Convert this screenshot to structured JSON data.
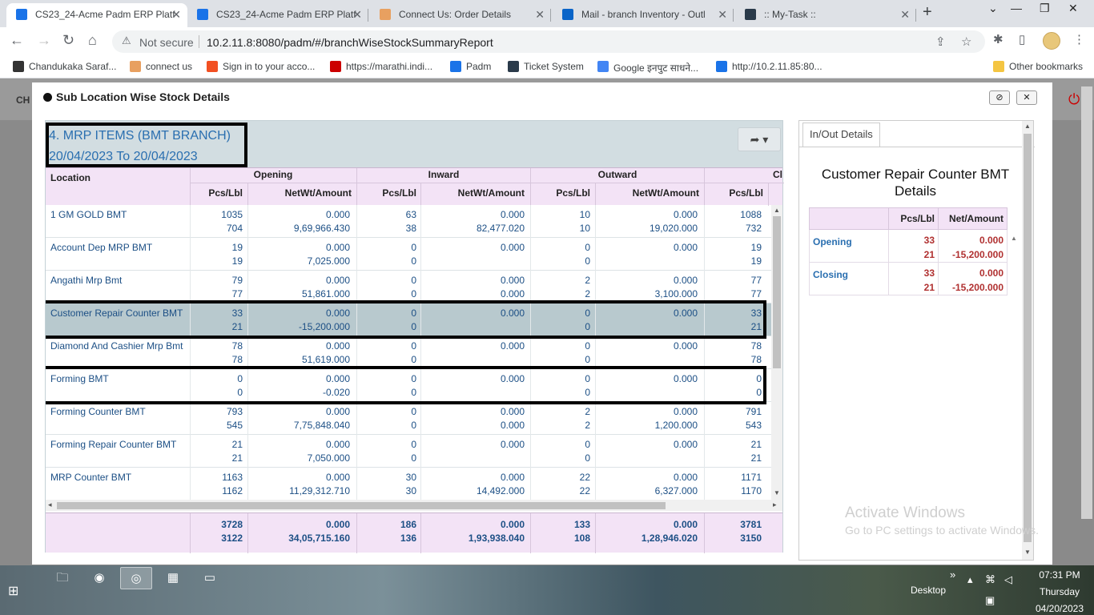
{
  "browser": {
    "tabs": [
      {
        "label": "CS23_24-Acme Padm ERP Platf",
        "active": true,
        "color": "#1a73e8"
      },
      {
        "label": "CS23_24-Acme Padm ERP Platf",
        "active": false,
        "color": "#1a73e8"
      },
      {
        "label": "Connect Us: Order Details",
        "active": false,
        "color": "#e8a060"
      },
      {
        "label": "Mail - branch Inventory - Outl",
        "active": false,
        "color": "#0a64c8"
      },
      {
        "label": ":: My-Task ::",
        "active": false,
        "color": "#2a3a4a"
      }
    ],
    "not_secure": "Not secure",
    "url": "10.2.11.8:8080/padm/#/branchWiseStockSummaryReport",
    "bookmarks": [
      {
        "label": "Chandukaka Saraf...",
        "color": "#333"
      },
      {
        "label": "connect us",
        "color": "#e8a060"
      },
      {
        "label": "Sign in to your acco...",
        "color": "#f25022"
      },
      {
        "label": "https://marathi.indi...",
        "color": "#c00"
      },
      {
        "label": "Padm",
        "color": "#1a73e8"
      },
      {
        "label": "Ticket System",
        "color": "#2a3a4a"
      },
      {
        "label": "Google इनपुट साधने...",
        "color": "#4285f4"
      },
      {
        "label": "http://10.2.11.85:80...",
        "color": "#1a73e8"
      }
    ],
    "other_bookmarks": "Other bookmarks"
  },
  "background": {
    "left_text": "CH"
  },
  "modal": {
    "title": "Sub Location Wise Stock Details",
    "report": {
      "title_line1": "4. MRP ITEMS (BMT BRANCH)",
      "title_line2": "20/04/2023 To 20/04/2023",
      "col_location": "Location",
      "groups": [
        "Opening",
        "Inward",
        "Outward",
        "Cl"
      ],
      "sub_pcs": "Pcs/Lbl",
      "sub_amt": "NetWt/Amount",
      "rows": [
        {
          "loc": "1 GM GOLD BMT",
          "op_p1": "1035",
          "op_p2": "704",
          "op_a1": "0.000",
          "op_a2": "9,69,966.430",
          "in_p1": "63",
          "in_p2": "38",
          "in_a1": "0.000",
          "in_a2": "82,477.020",
          "out_p1": "10",
          "out_p2": "10",
          "out_a1": "0.000",
          "out_a2": "19,020.000",
          "cl_p1": "1088",
          "cl_p2": "732"
        },
        {
          "loc": "Account Dep MRP BMT",
          "op_p1": "19",
          "op_p2": "19",
          "op_a1": "0.000",
          "op_a2": "7,025.000",
          "in_p1": "0",
          "in_p2": "0",
          "in_a1": "0.000",
          "in_a2": "",
          "out_p1": "0",
          "out_p2": "0",
          "out_a1": "0.000",
          "out_a2": "",
          "cl_p1": "19",
          "cl_p2": "19"
        },
        {
          "loc": "Angathi Mrp Bmt",
          "op_p1": "79",
          "op_p2": "77",
          "op_a1": "0.000",
          "op_a2": "51,861.000",
          "in_p1": "0",
          "in_p2": "0",
          "in_a1": "0.000",
          "in_a2": "0.000",
          "out_p1": "2",
          "out_p2": "2",
          "out_a1": "0.000",
          "out_a2": "3,100.000",
          "cl_p1": "77",
          "cl_p2": "77"
        },
        {
          "loc": "Customer Repair Counter BMT",
          "op_p1": "33",
          "op_p2": "21",
          "op_a1": "0.000",
          "op_a2": "-15,200.000",
          "in_p1": "0",
          "in_p2": "0",
          "in_a1": "0.000",
          "in_a2": "",
          "out_p1": "0",
          "out_p2": "0",
          "out_a1": "0.000",
          "out_a2": "",
          "cl_p1": "33",
          "cl_p2": "21"
        },
        {
          "loc": "Diamond And Cashier Mrp Bmt",
          "op_p1": "78",
          "op_p2": "78",
          "op_a1": "0.000",
          "op_a2": "51,619.000",
          "in_p1": "0",
          "in_p2": "0",
          "in_a1": "0.000",
          "in_a2": "",
          "out_p1": "0",
          "out_p2": "0",
          "out_a1": "0.000",
          "out_a2": "",
          "cl_p1": "78",
          "cl_p2": "78"
        },
        {
          "loc": "Forming BMT",
          "op_p1": "0",
          "op_p2": "0",
          "op_a1": "0.000",
          "op_a2": "-0.020",
          "in_p1": "0",
          "in_p2": "0",
          "in_a1": "0.000",
          "in_a2": "",
          "out_p1": "0",
          "out_p2": "0",
          "out_a1": "0.000",
          "out_a2": "",
          "cl_p1": "0",
          "cl_p2": "0"
        },
        {
          "loc": "Forming Counter BMT",
          "op_p1": "793",
          "op_p2": "545",
          "op_a1": "0.000",
          "op_a2": "7,75,848.040",
          "in_p1": "0",
          "in_p2": "0",
          "in_a1": "0.000",
          "in_a2": "0.000",
          "out_p1": "2",
          "out_p2": "2",
          "out_a1": "0.000",
          "out_a2": "1,200.000",
          "cl_p1": "791",
          "cl_p2": "543"
        },
        {
          "loc": "Forming Repair Counter BMT",
          "op_p1": "21",
          "op_p2": "21",
          "op_a1": "0.000",
          "op_a2": "7,050.000",
          "in_p1": "0",
          "in_p2": "0",
          "in_a1": "0.000",
          "in_a2": "",
          "out_p1": "0",
          "out_p2": "0",
          "out_a1": "0.000",
          "out_a2": "",
          "cl_p1": "21",
          "cl_p2": "21"
        },
        {
          "loc": "MRP Counter BMT",
          "op_p1": "1163",
          "op_p2": "1162",
          "op_a1": "0.000",
          "op_a2": "11,29,312.710",
          "in_p1": "30",
          "in_p2": "30",
          "in_a1": "0.000",
          "in_a2": "14,492.000",
          "out_p1": "22",
          "out_p2": "22",
          "out_a1": "0.000",
          "out_a2": "6,327.000",
          "cl_p1": "1171",
          "cl_p2": "1170"
        }
      ],
      "totals": {
        "op_p1": "3728",
        "op_p2": "3122",
        "op_a1": "0.000",
        "op_a2": "34,05,715.160",
        "in_p1": "186",
        "in_p2": "136",
        "in_a1": "0.000",
        "in_a2": "1,93,938.040",
        "out_p1": "133",
        "out_p2": "108",
        "out_a1": "0.000",
        "out_a2": "1,28,946.020",
        "cl_p1": "3781",
        "cl_p2": "3150"
      }
    },
    "side": {
      "tab_label": "In/Out Details",
      "title": "Customer Repair Counter BMT Details",
      "col_pcs": "Pcs/Lbl",
      "col_amt": "Net/Amount",
      "rows": [
        {
          "label": "Opening",
          "p1": "33",
          "p2": "21",
          "a1": "0.000",
          "a2": "-15,200.000"
        },
        {
          "label": "Closing",
          "p1": "33",
          "p2": "21",
          "a1": "0.000",
          "a2": "-15,200.000"
        }
      ]
    }
  },
  "watermark": {
    "line1": "Activate Windows",
    "line2": "Go to PC settings to activate Windows."
  },
  "taskbar": {
    "desktop_label": "Desktop",
    "time": "07:31 PM",
    "day": "Thursday",
    "date": "04/20/2023"
  }
}
